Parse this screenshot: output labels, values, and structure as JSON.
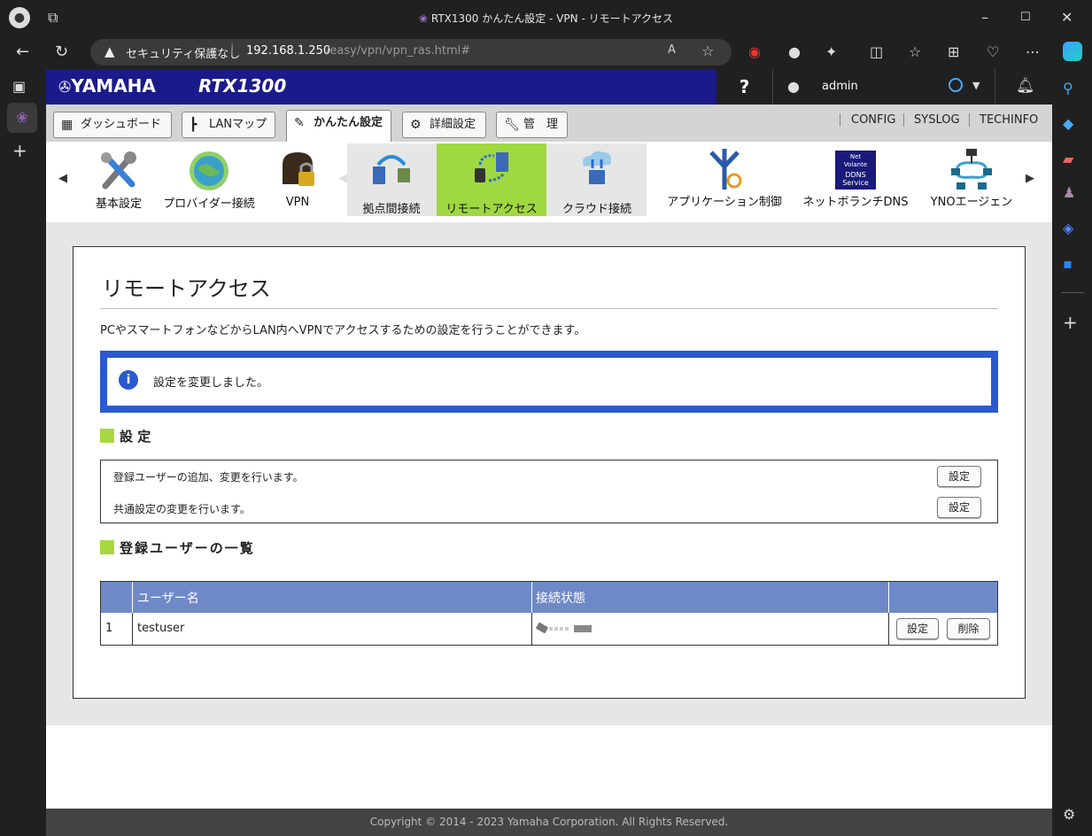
{
  "window": {
    "title": "RTX1300 かんたん設定 - VPN - リモートアクセス"
  },
  "browser": {
    "security": "セキュリティ保護なし",
    "url_host": "192.168.1.250",
    "url_path": "/easy/vpn/vpn_ras.html#"
  },
  "header": {
    "brand": "YAMAHA",
    "model": "RTX1300",
    "help": "?",
    "user": "admin"
  },
  "tabs": [
    {
      "label": "ダッシュボード"
    },
    {
      "label": "LANマップ"
    },
    {
      "label": "かんたん設定"
    },
    {
      "label": "詳細設定"
    },
    {
      "label": "管　理"
    }
  ],
  "toplinks": [
    "CONFIG",
    "SYSLOG",
    "TECHINFO"
  ],
  "icons": [
    {
      "label": "基本設定"
    },
    {
      "label": "プロバイダー接続"
    },
    {
      "label": "VPN"
    },
    {
      "label": "拠点間接続"
    },
    {
      "label": "リモートアクセス"
    },
    {
      "label": "クラウド接続"
    },
    {
      "label": "アプリケーション制御"
    },
    {
      "label": "ネットボランチDNS"
    },
    {
      "label": "YNOエージェン"
    }
  ],
  "ddns": {
    "line1": "Net",
    "line2": "Volante",
    "line3": "DDNS",
    "line4": "Service"
  },
  "main": {
    "title": "リモートアクセス",
    "description": "PCやスマートフォンなどからLAN内へVPNでアクセスするための設定を行うことができます。",
    "notice": "設定を変更しました。",
    "settings_heading": "設 定",
    "settings_rows": [
      {
        "text": "登録ユーザーの追加、変更を行います。",
        "button": "設定"
      },
      {
        "text": "共通設定の変更を行います。",
        "button": "設定"
      }
    ],
    "users_heading": "登録ユーザーの一覧",
    "table": {
      "headers": [
        "",
        "ユーザー名",
        "接続状態",
        ""
      ],
      "rows": [
        {
          "no": "1",
          "name": "testuser",
          "edit": "設定",
          "delete": "削除"
        }
      ]
    }
  },
  "footer": "Copyright © 2014 - 2023 Yamaha Corporation. All Rights Reserved."
}
